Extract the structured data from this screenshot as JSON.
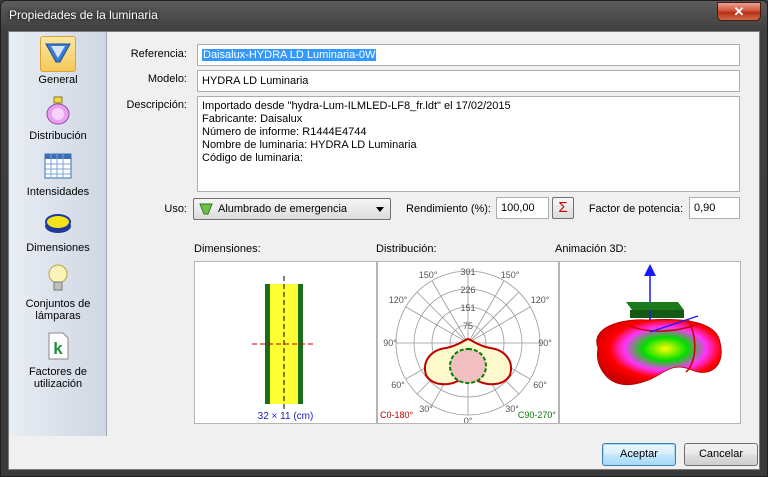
{
  "window": {
    "title": "Propiedades de la luminaria",
    "close_glyph": "✕"
  },
  "sidebar": {
    "items": [
      {
        "label": "General",
        "icon": "luminaire-icon"
      },
      {
        "label": "Distribución",
        "icon": "bottle-icon"
      },
      {
        "label": "Intensidades",
        "icon": "grid-table-icon"
      },
      {
        "label": "Dimensiones",
        "icon": "lamp-shape-icon"
      },
      {
        "label": "Conjuntos de lámparas",
        "icon": "bulb-icon"
      },
      {
        "label": "Factores de utilización",
        "icon": "k-document-icon"
      }
    ]
  },
  "form": {
    "referencia_label": "Referencia:",
    "referencia_value": "Daisalux-HYDRA LD Luminaria-0W",
    "modelo_label": "Modelo:",
    "modelo_value": "HYDRA LD Luminaria",
    "descripcion_label": "Descripción:",
    "descripcion_lines": [
      "Importado desde \"hydra-Lum-ILMLED-LF8_fr.ldt\" el 17/02/2015",
      "Fabricante: Daisalux",
      "Número de informe: R1444E4744",
      "Nombre de luminaria: HYDRA LD Luminaria",
      "Código de luminaria:"
    ],
    "uso_label": "Uso:",
    "uso_value": "Alumbrado de emergencia",
    "rendimiento_label": "Rendimiento (%):",
    "rendimiento_value": "100,00",
    "sigma_glyph": "Σ",
    "factor_label": "Factor de potencia:",
    "factor_value": "0,90"
  },
  "panels": {
    "dimensiones_label": "Dimensiones:",
    "dimensiones_caption": "32 × 11 (cm)",
    "distribucion_label": "Distribución:",
    "animacion_label": "Animación 3D:",
    "polar_ticks": [
      "301",
      "226",
      "151",
      "75"
    ],
    "angle_labels": [
      "150°",
      "150°",
      "120°",
      "120°",
      "90°",
      "90°",
      "60°",
      "60°",
      "30°",
      "30°",
      "0°"
    ],
    "legend_c0": "C0-180°",
    "legend_c90": "C90-270°",
    "colors": {
      "c0": "#c00000",
      "c90": "#008000",
      "accent": "#3399ff"
    }
  },
  "buttons": {
    "accept": "Aceptar",
    "cancel": "Cancelar"
  }
}
